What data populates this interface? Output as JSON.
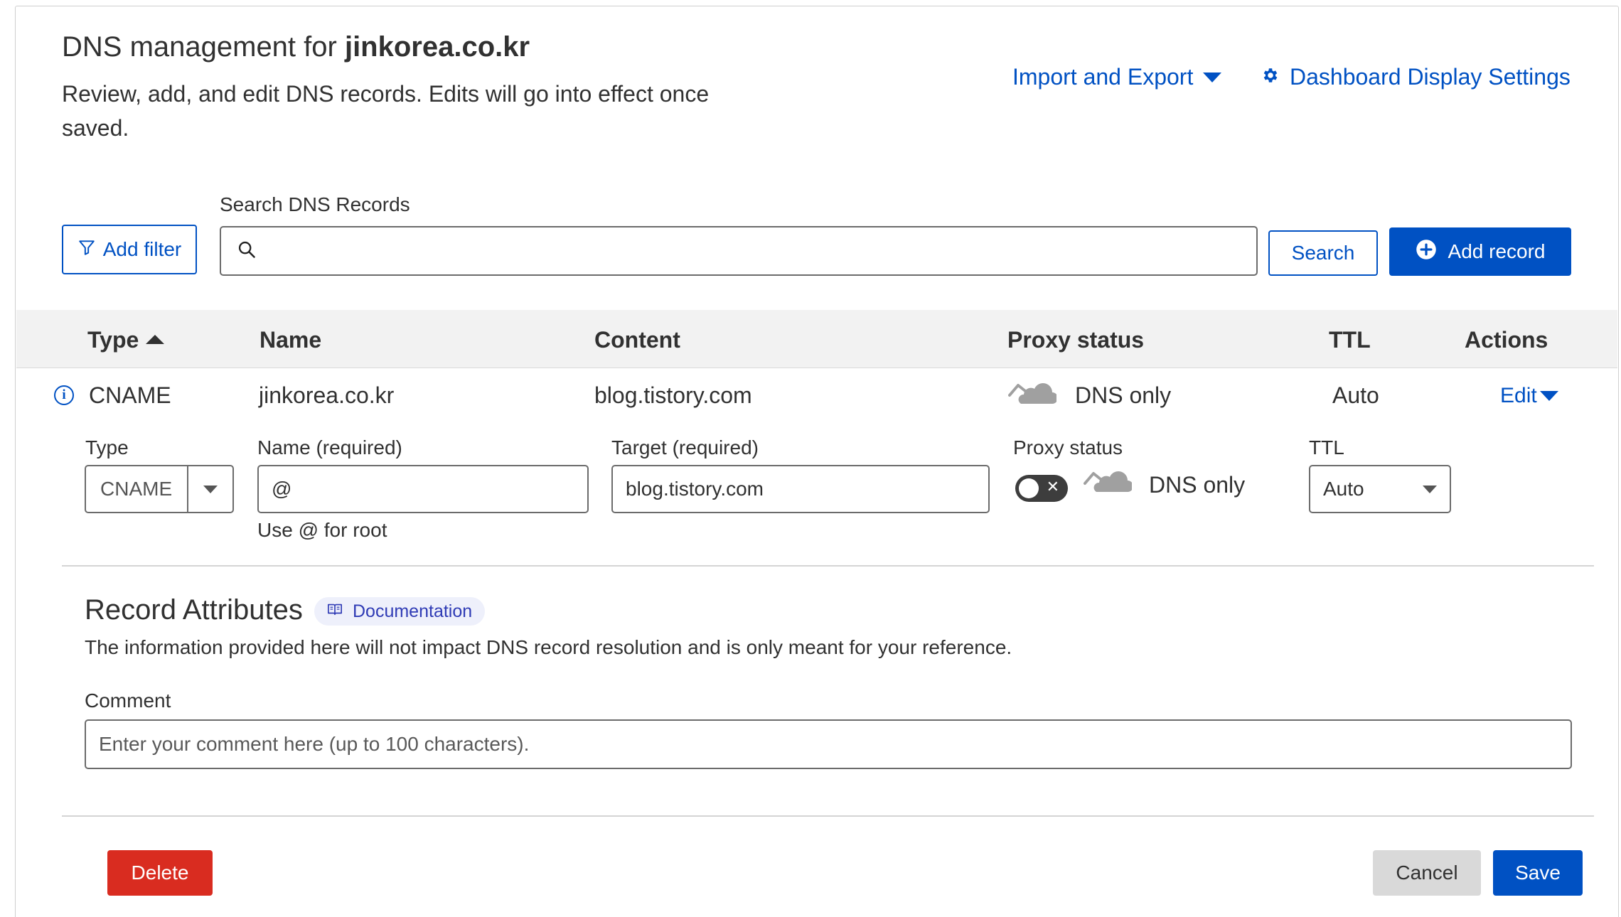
{
  "header": {
    "title_prefix": "DNS management for ",
    "domain": "jinkorea.co.kr",
    "subtitle": "Review, add, and edit DNS records. Edits will go into effect once saved.",
    "import_export_label": "Import and Export",
    "dashboard_settings_label": "Dashboard Display Settings"
  },
  "toolbar": {
    "search_label": "Search DNS Records",
    "search_value": "",
    "add_filter_label": "Add filter",
    "search_button_label": "Search",
    "add_record_label": "Add record"
  },
  "table": {
    "columns": [
      "Type",
      "Name",
      "Content",
      "Proxy status",
      "TTL",
      "Actions"
    ],
    "sort_column": "Type",
    "sort_direction": "ascending",
    "rows": [
      {
        "type": "CNAME",
        "name": "jinkorea.co.kr",
        "content": "blog.tistory.com",
        "proxy_status": "DNS only",
        "ttl": "Auto",
        "action": "Edit"
      }
    ]
  },
  "edit_form": {
    "type_label": "Type",
    "type_value": "CNAME",
    "name_label": "Name (required)",
    "name_value": "@",
    "name_hint": "Use @ for root",
    "target_label": "Target (required)",
    "target_value": "blog.tistory.com",
    "proxy_label": "Proxy status",
    "proxy_enabled": false,
    "proxy_value": "DNS only",
    "ttl_label": "TTL",
    "ttl_value": "Auto"
  },
  "attributes": {
    "title": "Record Attributes",
    "doc_badge": "Documentation",
    "description": "The information provided here will not impact DNS record resolution and is only meant for your reference.",
    "comment_label": "Comment",
    "comment_placeholder": "Enter your comment here (up to 100 characters).",
    "comment_value": ""
  },
  "actions": {
    "delete_label": "Delete",
    "cancel_label": "Cancel",
    "save_label": "Save"
  },
  "colors": {
    "accent": "#0051c3",
    "danger": "#d92c20",
    "cloud_gray": "#9a9a9a",
    "header_bg": "#f2f2f2"
  },
  "icons": {
    "filter": "filter-icon",
    "search": "search-icon",
    "add": "plus-circle-icon",
    "gear": "gear-icon",
    "info": "info-icon",
    "cloud": "cloud-dns-only-icon",
    "book": "book-icon"
  }
}
